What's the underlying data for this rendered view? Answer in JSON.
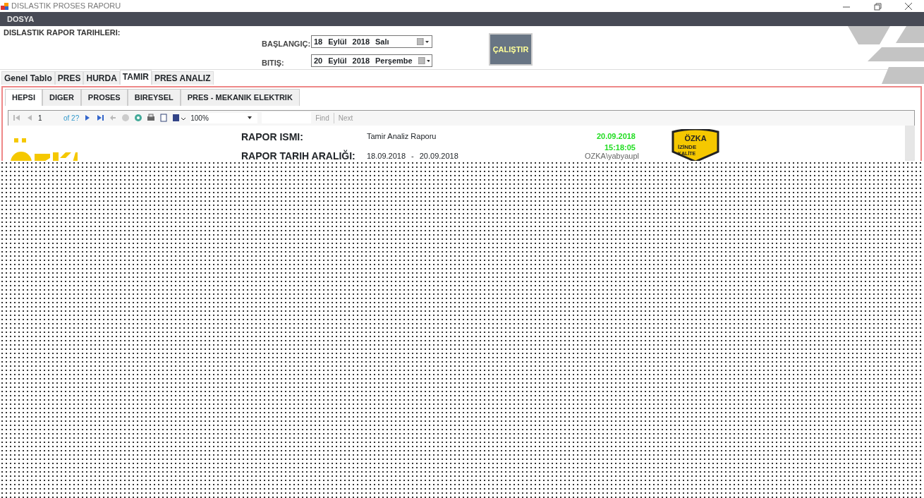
{
  "window": {
    "title": "DISLASTIK PROSES RAPORU"
  },
  "menu": [
    {
      "label": "DOSYA"
    }
  ],
  "date_group": {
    "title": "DISLASTIK RAPOR TARIHLERI:",
    "fields": [
      {
        "label": "BAŞLANGIÇ:",
        "day": "18",
        "month": "Eylül",
        "year": "2018",
        "weekday": "Salı"
      },
      {
        "label": "BITIŞ:",
        "day": "20",
        "month": "Eylül",
        "year": "2018",
        "weekday": "Perşembe"
      }
    ],
    "run_button": "ÇALIŞTIR"
  },
  "tabs": [
    {
      "label": "Genel Tablo",
      "selected": false
    },
    {
      "label": "PRES",
      "selected": false
    },
    {
      "label": "HURDA",
      "selected": false
    },
    {
      "label": "TAMIR",
      "selected": true
    },
    {
      "label": "PRES ANALIZ",
      "selected": false
    }
  ],
  "subtabs": [
    {
      "label": "HEPSI",
      "selected": true
    },
    {
      "label": "DIGER",
      "selected": false
    },
    {
      "label": "PROSES",
      "selected": false
    },
    {
      "label": "BIREYSEL",
      "selected": false
    },
    {
      "label": "PRES - MEKANIK ELEKTRIK",
      "selected": false
    }
  ],
  "toolbar": {
    "page": "1",
    "page_count": "of 2?",
    "zoom": "100%",
    "find": "Find",
    "next": "Next"
  },
  "report": {
    "name_label": "RAPOR ISMI:",
    "name_value": "Tamir Analiz Raporu",
    "range_label": "RAPOR TARIH ARALIĞI:",
    "range_start": "18.09.2018",
    "range_sep": "-",
    "range_end": "20.09.2018",
    "print_date": "20.09.2018",
    "print_time": "15:18:05",
    "user": "OZKA\\yabyaupl",
    "badge": {
      "brand": "ÖZKA",
      "line1": "İZİNDE",
      "line2": "KALİTE"
    }
  }
}
